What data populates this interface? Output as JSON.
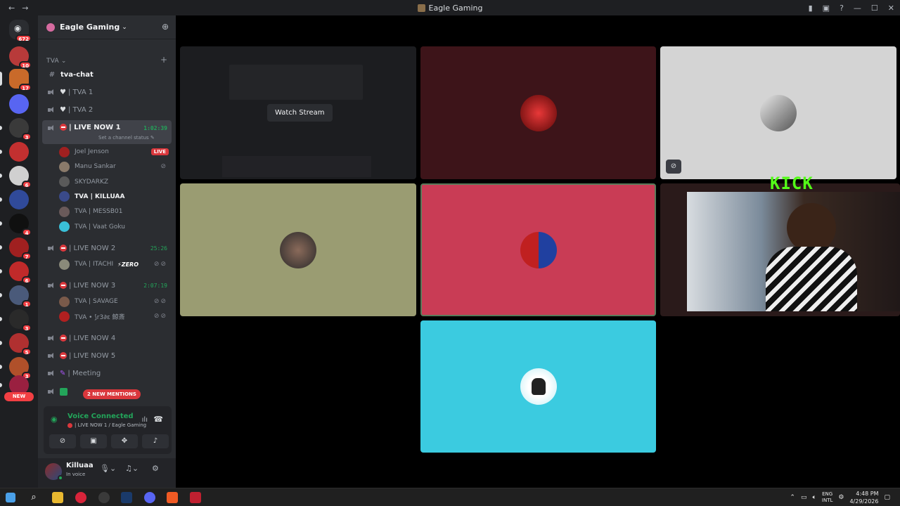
{
  "window": {
    "title": "Eagle Gaming",
    "back_label": "←",
    "forward_label": "→"
  },
  "rail": {
    "home_badge": "672",
    "servers": [
      {
        "color": "#b83a3a",
        "badge": "10"
      },
      {
        "color": "#c96a2a",
        "badge": "17",
        "selected": true
      },
      {
        "color": "#5865f2",
        "badge": ""
      },
      {
        "color": "#3a3a3a",
        "badge": "3"
      },
      {
        "color": "#c23030",
        "badge": ""
      },
      {
        "color": "#d0d0d0",
        "badge": "6"
      },
      {
        "color": "#304a9a",
        "badge": ""
      },
      {
        "color": "#101010",
        "badge": "4"
      },
      {
        "color": "#a02020",
        "badge": "7"
      },
      {
        "color": "#c02a2a",
        "badge": "6"
      },
      {
        "color": "#4a5a7a",
        "badge": "1"
      },
      {
        "color": "#2a2a2a",
        "badge": "3"
      },
      {
        "color": "#b03030",
        "badge": "5"
      },
      {
        "color": "#b0502a",
        "badge": "3"
      },
      {
        "color": "#9a2040",
        "badge": ""
      }
    ],
    "new_label": "NEW"
  },
  "sidebar": {
    "guild_name": "Eagle Gaming",
    "category": "TVA",
    "text_channel": "tva-chat",
    "channels": [
      {
        "name": "| TVA 1"
      },
      {
        "name": "| TVA 2"
      }
    ],
    "live1": {
      "name": "| LIVE NOW 1",
      "timer": "1:02:39",
      "status": "Set a channel status"
    },
    "live1_users": [
      {
        "name": "Joel Jenson",
        "badge": "LIVE",
        "color": "#a02020"
      },
      {
        "name": "Manu Sankar",
        "badge": "",
        "color": "#8a7a6a"
      },
      {
        "name": "SKYDARKZ",
        "badge": "",
        "color": "#5a5a5a"
      },
      {
        "name": "TVA | KILLUAA",
        "badge": "",
        "color": "#3a4a8a"
      },
      {
        "name": "TVA | MESSB01",
        "badge": "",
        "color": "#6a5a5a"
      },
      {
        "name": "TVA | Vaat Goku",
        "badge": "",
        "color": "#3ac0d8"
      }
    ],
    "live2": {
      "name": "| LIVE NOW 2",
      "timer": "25:26"
    },
    "live2_users": [
      {
        "name": "TVA | ITACHI",
        "tag": "ZERO",
        "color": "#8a8a7a"
      }
    ],
    "live3": {
      "name": "| LIVE NOW 3",
      "timer": "2:07:19"
    },
    "live3_users": [
      {
        "name": "TVA | SAVAGE",
        "color": "#7a5a4a"
      },
      {
        "name": "TVA • ⟆r3∂ε 鯨斎",
        "color": "#b02020"
      }
    ],
    "live4": {
      "name": "| LIVE NOW 4"
    },
    "live5": {
      "name": "| LIVE NOW 5"
    },
    "meeting": {
      "name": "| Meeting"
    },
    "mentions": "2 NEW MENTIONS"
  },
  "voice": {
    "title": "Voice Connected",
    "sub": "| LIVE NOW 1 / Eagle Gaming"
  },
  "user": {
    "name": "Killuaa",
    "status": "In voice"
  },
  "stage": {
    "watch_label": "Watch Stream",
    "kick_label": "KICK",
    "tiles": [
      {
        "bg": "#1c1d20"
      },
      {
        "bg": "#3d1419"
      },
      {
        "bg": "#d4d4d4"
      },
      {
        "bg": "#9a9c72"
      },
      {
        "bg": "#c93c55"
      },
      {
        "bg": "#2a1a1a"
      },
      {
        "bg": "#3bcbe0"
      }
    ]
  },
  "taskbar": {
    "lang_top": "ENG",
    "lang_bottom": "INTL",
    "time": "4:48 PM",
    "date": "4/29/2026"
  }
}
